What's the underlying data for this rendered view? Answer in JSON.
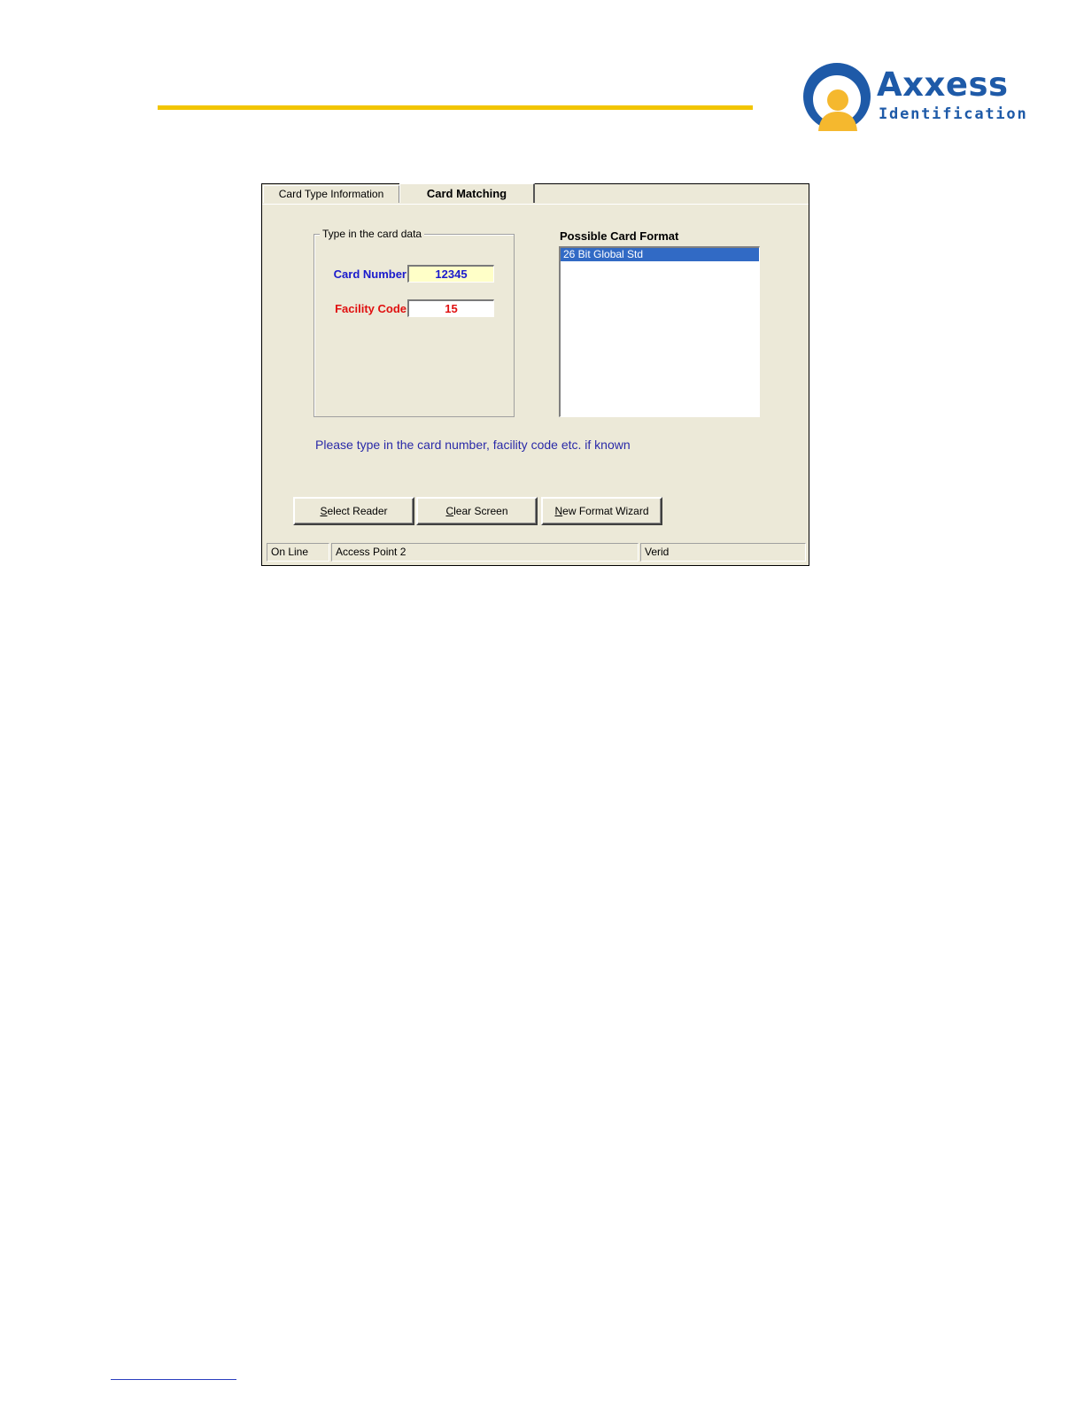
{
  "header": {
    "rule_color": "#f2c500",
    "logo": {
      "name": "Axxess",
      "tagline": "Identification",
      "brand_color": "#1e5aa8",
      "icon": "person-badge-icon"
    }
  },
  "window": {
    "tabs": [
      {
        "label": "Card Type Information",
        "active": false
      },
      {
        "label": "Card Matching",
        "active": true
      }
    ],
    "card_data_group": {
      "legend": "Type in the card data",
      "card_number": {
        "label": "Card Number",
        "value": "12345",
        "label_color": "#1a1acc",
        "bg": "#ffffc8"
      },
      "facility_code": {
        "label": "Facility Code",
        "value": "15",
        "label_color": "#e01010"
      }
    },
    "possible_formats": {
      "title": "Possible Card Format",
      "items": [
        {
          "label": "26 Bit Global Std",
          "selected": true
        }
      ]
    },
    "hint": "Please type in the card number, facility code etc. if known",
    "buttons": {
      "select_reader": {
        "accel": "S",
        "rest": "elect Reader"
      },
      "clear_screen": {
        "accel": "C",
        "rest": "lear Screen"
      },
      "new_format_wizard": {
        "accel": "N",
        "rest": "ew Format Wizard"
      }
    },
    "status": {
      "connection": "On Line",
      "access_point": "Access Point 2",
      "reader": "Verid"
    }
  }
}
